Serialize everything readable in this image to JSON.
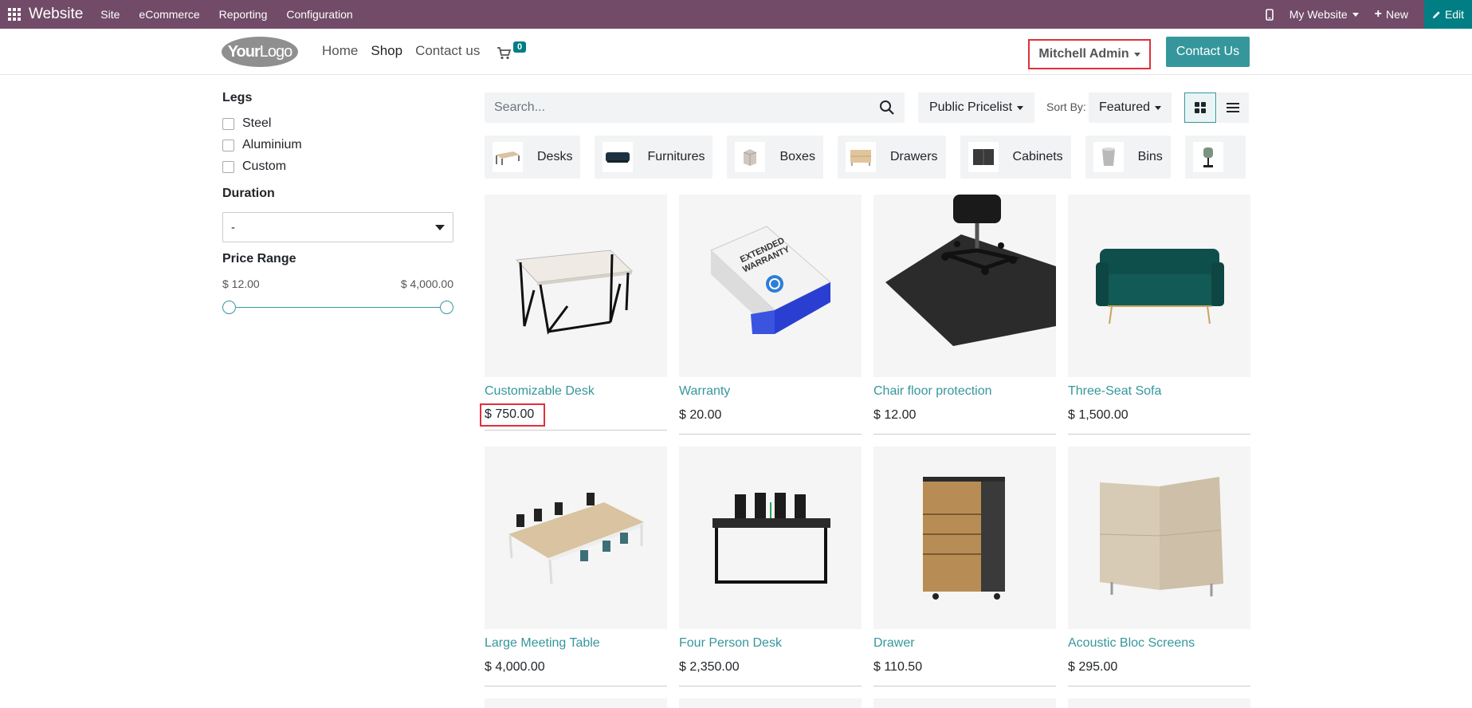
{
  "admin_bar": {
    "brand": "Website",
    "menus": [
      "Site",
      "eCommerce",
      "Reporting",
      "Configuration"
    ],
    "website_selector": "My Website",
    "new_label": "New",
    "edit_label": "Edit",
    "bg_color": "#714b67"
  },
  "header": {
    "logo": {
      "bold": "Your",
      "thin": "Logo"
    },
    "nav": [
      "Home",
      "Shop",
      "Contact us"
    ],
    "cart_count": "0",
    "user_name": "Mitchell Admin",
    "contact_button": "Contact Us"
  },
  "filters": {
    "legs_title": "Legs",
    "legs_options": [
      "Steel",
      "Aluminium",
      "Custom"
    ],
    "duration_title": "Duration",
    "duration_value": "-",
    "price_title": "Price Range",
    "price_min": "$ 12.00",
    "price_max": "$ 4,000.00"
  },
  "toolbar": {
    "search_placeholder": "Search...",
    "pricelist": "Public Pricelist",
    "sort_label": "Sort By:",
    "sort_value": "Featured"
  },
  "categories": [
    "Desks",
    "Furnitures",
    "Boxes",
    "Drawers",
    "Cabinets",
    "Bins",
    ""
  ],
  "products": [
    {
      "name": "Customizable Desk",
      "price": "$ 750.00"
    },
    {
      "name": "Warranty",
      "price": "$ 20.00"
    },
    {
      "name": "Chair floor protection",
      "price": "$ 12.00"
    },
    {
      "name": "Three-Seat Sofa",
      "price": "$ 1,500.00"
    },
    {
      "name": "Large Meeting Table",
      "price": "$ 4,000.00"
    },
    {
      "name": "Four Person Desk",
      "price": "$ 2,350.00"
    },
    {
      "name": "Drawer",
      "price": "$ 110.50"
    },
    {
      "name": "Acoustic Bloc Screens",
      "price": "$ 295.00"
    }
  ],
  "colors": {
    "accent": "#35979c",
    "highlight": "#e0303a"
  }
}
